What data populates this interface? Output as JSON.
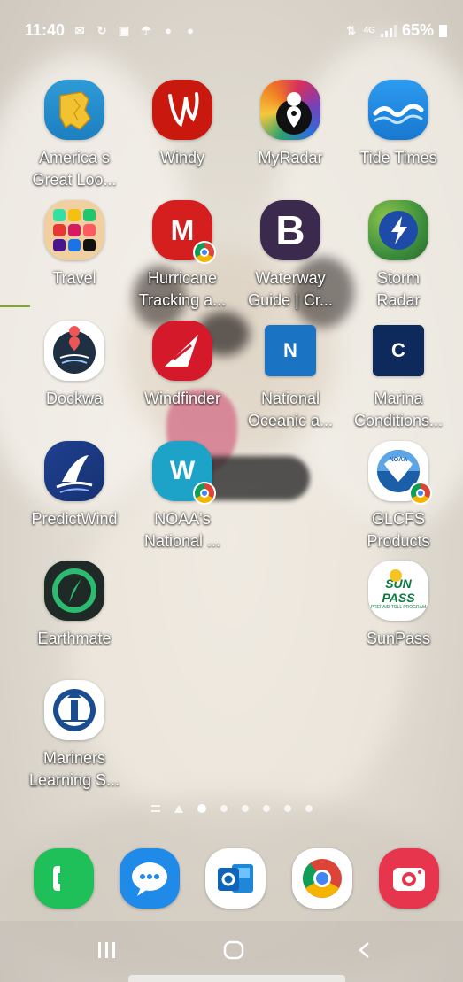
{
  "status_bar": {
    "time": "11:40",
    "network": "4G",
    "battery": "65%",
    "notification_icons": [
      "gmail-icon",
      "sync-icon",
      "gallery-icon",
      "weather-icon",
      "app-notification-icon",
      "app-notification-icon"
    ]
  },
  "apps": [
    {
      "name": "americas-great-loop",
      "label": "America s\nGreat Loo...",
      "icon": "map-icon"
    },
    {
      "name": "windy",
      "label": "Windy",
      "icon": "windy-icon"
    },
    {
      "name": "myradar",
      "label": "MyRadar",
      "icon": "radar-pin-icon"
    },
    {
      "name": "tide-times",
      "label": "Tide Times",
      "icon": "waves-icon"
    },
    {
      "name": "travel-folder",
      "label": "Travel",
      "icon": "folder-icon"
    },
    {
      "name": "hurricane-tracking",
      "label": "Hurricane\nTracking a...",
      "icon": "hurricane-icon",
      "badge_letter": "M"
    },
    {
      "name": "waterway-guide",
      "label": "Waterway\nGuide | Cr...",
      "icon": "b-letter-icon",
      "badge_letter": "B"
    },
    {
      "name": "storm-radar",
      "label": "Storm\nRadar",
      "icon": "storm-icon"
    },
    {
      "name": "dockwa",
      "label": "Dockwa",
      "icon": "dockwa-icon"
    },
    {
      "name": "windfinder",
      "label": "Windfinder",
      "icon": "windfinder-icon"
    },
    {
      "name": "national-oceanic",
      "label": "National\nOceanic a...",
      "icon": "n-letter-icon",
      "badge_letter": "N"
    },
    {
      "name": "marina-conditions",
      "label": "Marina\nConditions...",
      "icon": "c-letter-icon",
      "badge_letter": "C"
    },
    {
      "name": "predictwind",
      "label": "PredictWind",
      "icon": "sail-icon"
    },
    {
      "name": "noaas-national",
      "label": "NOAA's\nNational ...",
      "icon": "w-letter-icon",
      "badge_letter": "W"
    },
    {
      "name": "glcfs-products",
      "label": "GLCFS\nProducts",
      "icon": "noaa-icon",
      "badge_letter": "NOAA"
    },
    {
      "name": "earthmate",
      "label": "Earthmate",
      "icon": "earthmate-icon"
    },
    {
      "name": "sunpass",
      "label": "SunPass",
      "icon": "sunpass-icon",
      "logo_text": "SUN PASS",
      "logo_sub": "PREPAID TOLL PROGRAM"
    },
    {
      "name": "mariners-learning",
      "label": "Mariners\nLearning S...",
      "icon": "lighthouse-icon"
    }
  ],
  "dock": [
    {
      "name": "phone",
      "icon": "phone-icon"
    },
    {
      "name": "messages",
      "icon": "messages-icon"
    },
    {
      "name": "outlook",
      "icon": "outlook-icon"
    },
    {
      "name": "chrome",
      "icon": "chrome-icon"
    },
    {
      "name": "camera",
      "icon": "camera-icon"
    }
  ],
  "nav": {
    "recent": "recent-apps-icon",
    "home": "home-icon",
    "back": "back-icon"
  },
  "colors": {
    "windy_red": "#c9190f",
    "tide_blue": "#1c8de6",
    "hurricane_red": "#d51e1e",
    "waterway_purple": "#3b2a4e",
    "noaa_blue": "#1b73c4",
    "marina_navy": "#0e2a5c",
    "windfinder_red": "#d41a2a",
    "noaa_teal": "#1ea3c8",
    "earthmate_green": "#2dbb72",
    "dock_green": "#1fbf5a",
    "dock_blue": "#1f8ae8",
    "camera_red": "#e8354e"
  }
}
